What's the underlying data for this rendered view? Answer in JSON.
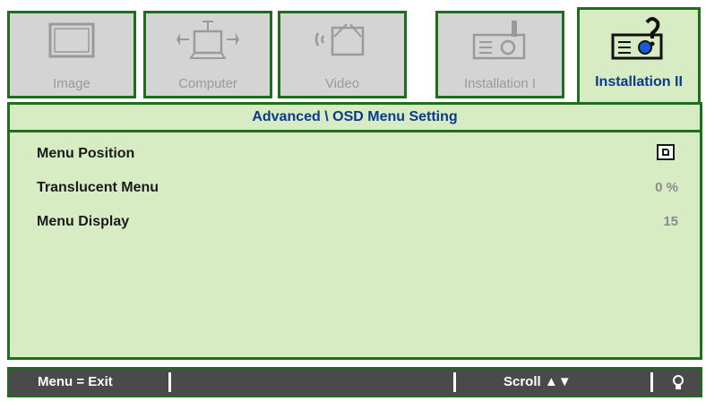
{
  "tabs": [
    {
      "label": "Image",
      "icon": "image-icon"
    },
    {
      "label": "Computer",
      "icon": "computer-icon"
    },
    {
      "label": "Video",
      "icon": "video-icon"
    },
    {
      "label": "Installation I",
      "icon": "installation-icon"
    },
    {
      "label": "Installation II",
      "icon": "projector-icon",
      "active": true
    }
  ],
  "panel": {
    "title": "Advanced \\ OSD Menu Setting",
    "rows": [
      {
        "label": "Menu Position",
        "value": ""
      },
      {
        "label": "Translucent Menu",
        "value": "0 %"
      },
      {
        "label": "Menu Display",
        "value": "15"
      }
    ]
  },
  "bottom_bar": {
    "exit_label": "Menu = Exit",
    "scroll_label": "Scroll ▲▼"
  },
  "colors": {
    "panel_bg": "#d8ecc4",
    "border": "#1e6e1e",
    "title_text": "#0a3a8c",
    "bar_bg": "#4a4a4a"
  }
}
